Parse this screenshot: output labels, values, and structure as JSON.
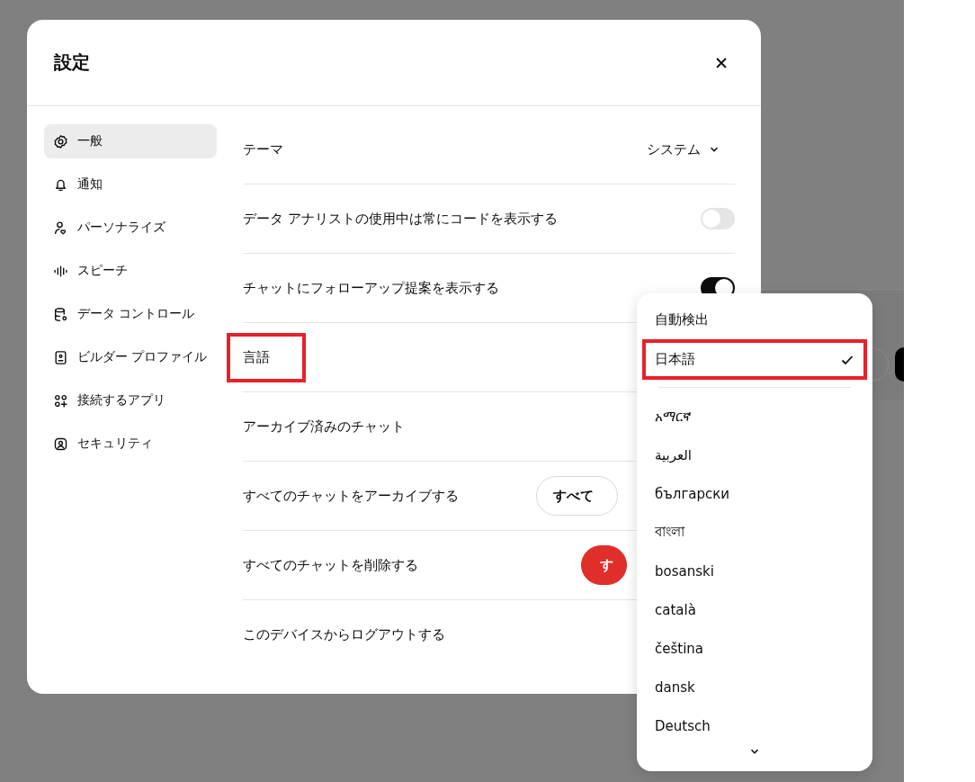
{
  "dialog": {
    "title": "設定"
  },
  "sidebar": {
    "items": [
      {
        "label": "一般",
        "selected": true
      },
      {
        "label": "通知",
        "selected": false
      },
      {
        "label": "パーソナライズ",
        "selected": false
      },
      {
        "label": "スピーチ",
        "selected": false
      },
      {
        "label": "データ コントロール",
        "selected": false
      },
      {
        "label": "ビルダー プロファイル",
        "selected": false
      },
      {
        "label": "接続するアプリ",
        "selected": false
      },
      {
        "label": "セキュリティ",
        "selected": false
      }
    ]
  },
  "settings": [
    {
      "kind": "select",
      "label": "テーマ",
      "value": "システム"
    },
    {
      "kind": "toggle",
      "label": "データ アナリストの使用中は常にコードを表示する",
      "on": false
    },
    {
      "kind": "toggle",
      "label": "チャットにフォローアップ提案を表示する",
      "on": true
    },
    {
      "kind": "plain",
      "label": "言語",
      "annotated": true
    },
    {
      "kind": "plain",
      "label": "アーカイブ済みのチャット"
    },
    {
      "kind": "button",
      "label": "すべてのチャットをアーカイブする",
      "button": "すべて"
    },
    {
      "kind": "danger",
      "label": "すべてのチャットを削除する",
      "button": "す"
    },
    {
      "kind": "plain",
      "label": "このデバイスからログアウトする"
    }
  ],
  "language_menu": {
    "top": [
      {
        "label": "自動検出",
        "selected": false,
        "annotated": false
      },
      {
        "label": "日本語",
        "selected": true,
        "annotated": true
      }
    ],
    "items": [
      {
        "label": "አማርኛ",
        "selected": false
      },
      {
        "label": "العربية",
        "selected": false
      },
      {
        "label": "български",
        "selected": false
      },
      {
        "label": "বাংলা",
        "selected": false
      },
      {
        "label": "bosanski",
        "selected": false
      },
      {
        "label": "català",
        "selected": false
      },
      {
        "label": "čeština",
        "selected": false
      },
      {
        "label": "dansk",
        "selected": false
      },
      {
        "label": "Deutsch",
        "selected": false
      }
    ]
  }
}
